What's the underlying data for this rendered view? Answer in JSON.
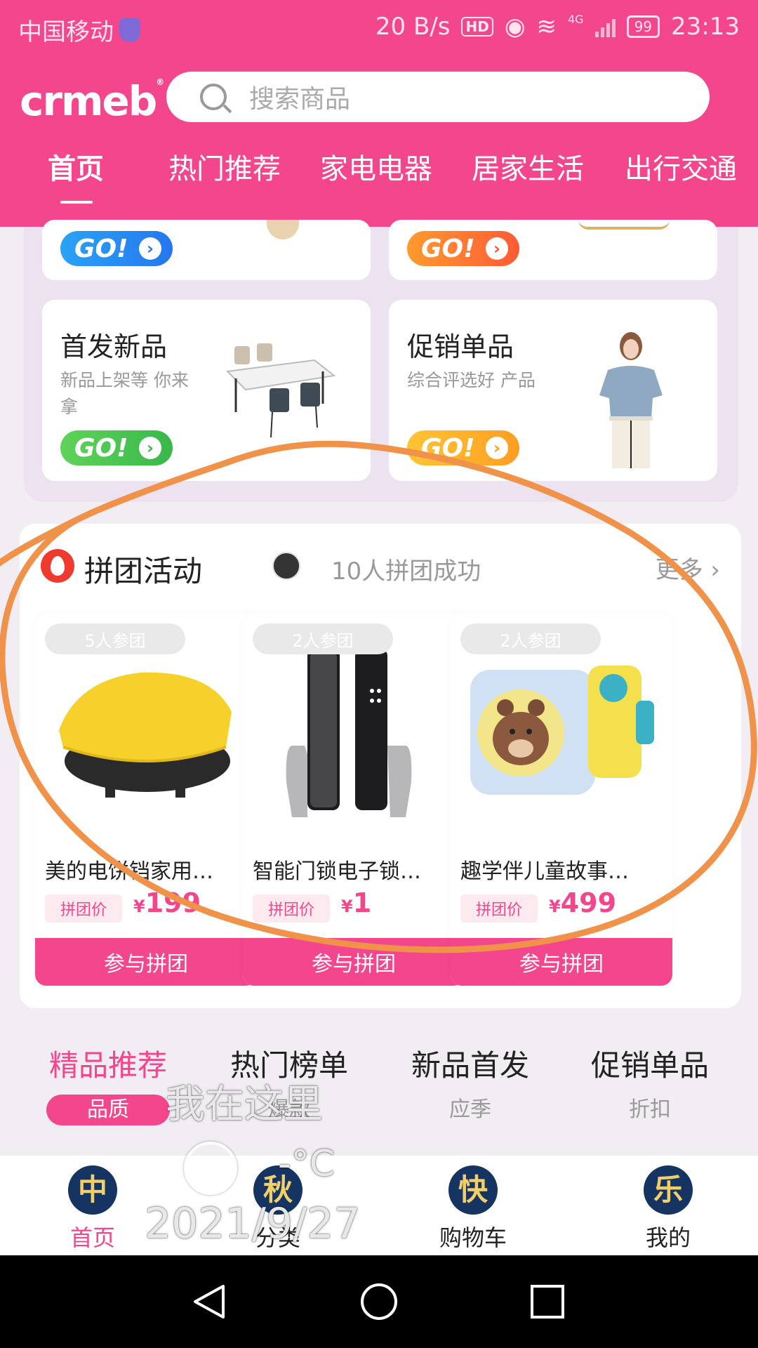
{
  "status_bar": {
    "carrier": "中国移动",
    "net_speed": "20 B/s",
    "hd": "HD",
    "network": "4G",
    "battery": "99",
    "time": "23:13"
  },
  "header": {
    "logo": "crmeb",
    "logo_mark": "®",
    "search_placeholder": "搜索商品",
    "tabs": [
      "首页",
      "热门推荐",
      "家电电器",
      "居家生活",
      "出行交通"
    ],
    "active_tab": "首页"
  },
  "activities": [
    {
      "title": "首发新品",
      "subtitle": "新品上架等 你来拿",
      "go": "GO!"
    },
    {
      "title": "促销单品",
      "subtitle": "综合评选好 产品",
      "go": "GO!"
    },
    {
      "go": "GO!"
    },
    {
      "go": "GO!"
    }
  ],
  "group_buy": {
    "title": "拼团活动",
    "count_text": "10人拼团成功",
    "more": "更多 ›",
    "price_label": "拼团价",
    "currency": "¥",
    "join_label": "参与拼团",
    "products": [
      {
        "badge": "5人参团",
        "name": "美的电饼铛家用…",
        "price": "199"
      },
      {
        "badge": "2人参团",
        "name": "智能门锁电子锁…",
        "price": "1"
      },
      {
        "badge": "2人参团",
        "name": "趣学伴儿童故事…",
        "price": "499"
      }
    ]
  },
  "recommend": [
    {
      "title": "精品推荐",
      "sub": "品质"
    },
    {
      "title": "热门榜单",
      "sub": "爆款"
    },
    {
      "title": "新品首发",
      "sub": "应季"
    },
    {
      "title": "促销单品",
      "sub": "折扣"
    }
  ],
  "tabbar": [
    {
      "emblem": "中",
      "label": "首页"
    },
    {
      "emblem": "秋",
      "label": "分类"
    },
    {
      "emblem": "快",
      "label": "购物车"
    },
    {
      "emblem": "乐",
      "label": "我的"
    }
  ],
  "watermark": {
    "text": "我在这里",
    "temp": "-°C",
    "date": "2021/9/27"
  },
  "colors": {
    "brand_pink": "#f4468d",
    "annotation_orange": "#f0924a"
  }
}
